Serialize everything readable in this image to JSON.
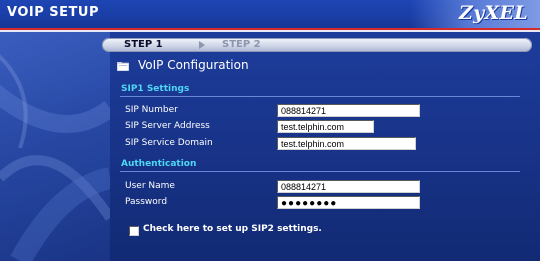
{
  "header": {
    "title": "VOIP SETUP",
    "logo_text": "ZyXEL"
  },
  "steps": [
    {
      "label": "STEP 1",
      "active": true
    },
    {
      "label": "STEP 2",
      "active": false
    }
  ],
  "page": {
    "title": "VoIP Configuration",
    "title_icon": "folder-icon"
  },
  "sip1": {
    "heading": "SIP1   Settings",
    "fields": {
      "sip_number": {
        "label": "SIP Number",
        "value": "088814271"
      },
      "sip_server_address": {
        "label": "SIP Server Address",
        "value": "test.telphin.com"
      },
      "sip_service_domain": {
        "label": "SIP Service Domain",
        "value": "test.telphin.com"
      }
    }
  },
  "auth": {
    "heading": "Authentication",
    "fields": {
      "user_name": {
        "label": "User Name",
        "value": "088814271"
      },
      "password": {
        "label": "Password",
        "value": "●●●●●●●●"
      }
    }
  },
  "sip2_checkbox": {
    "label": "Check here to set up SIP2 settings.",
    "checked": false
  },
  "colors": {
    "accent_cyan": "#4fd6f4",
    "header_red_line": "#d82a2a",
    "background_blue": "#1a3790"
  }
}
